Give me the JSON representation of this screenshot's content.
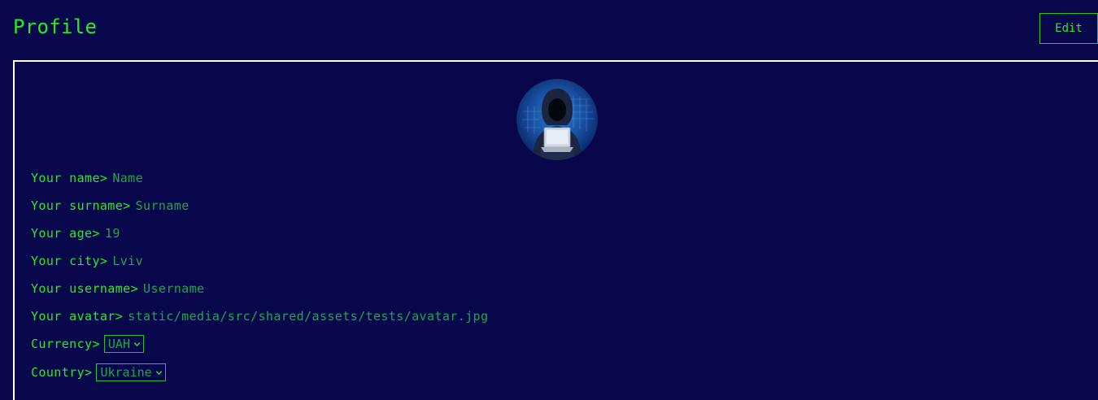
{
  "header": {
    "title": "Profile",
    "edit_label": "Edit"
  },
  "profile": {
    "avatar_icon": "hooded-hacker-avatar",
    "fields": [
      {
        "label": "Your name>",
        "value": "Name"
      },
      {
        "label": "Your surname>",
        "value": "Surname"
      },
      {
        "label": "Your age>",
        "value": "19"
      },
      {
        "label": "Your city>",
        "value": "Lviv"
      },
      {
        "label": "Your username>",
        "value": "Username"
      },
      {
        "label": "Your avatar>",
        "value": "static/media/src/shared/assets/tests/avatar.jpg"
      }
    ],
    "currency": {
      "label": "Currency>",
      "selected": "UAH"
    },
    "country": {
      "label": "Country>",
      "selected": "Ukraine"
    }
  },
  "colors": {
    "background": "#09074b",
    "accent": "#22ee22",
    "value_text": "#1aa84a",
    "card_border": "#ffffff"
  }
}
